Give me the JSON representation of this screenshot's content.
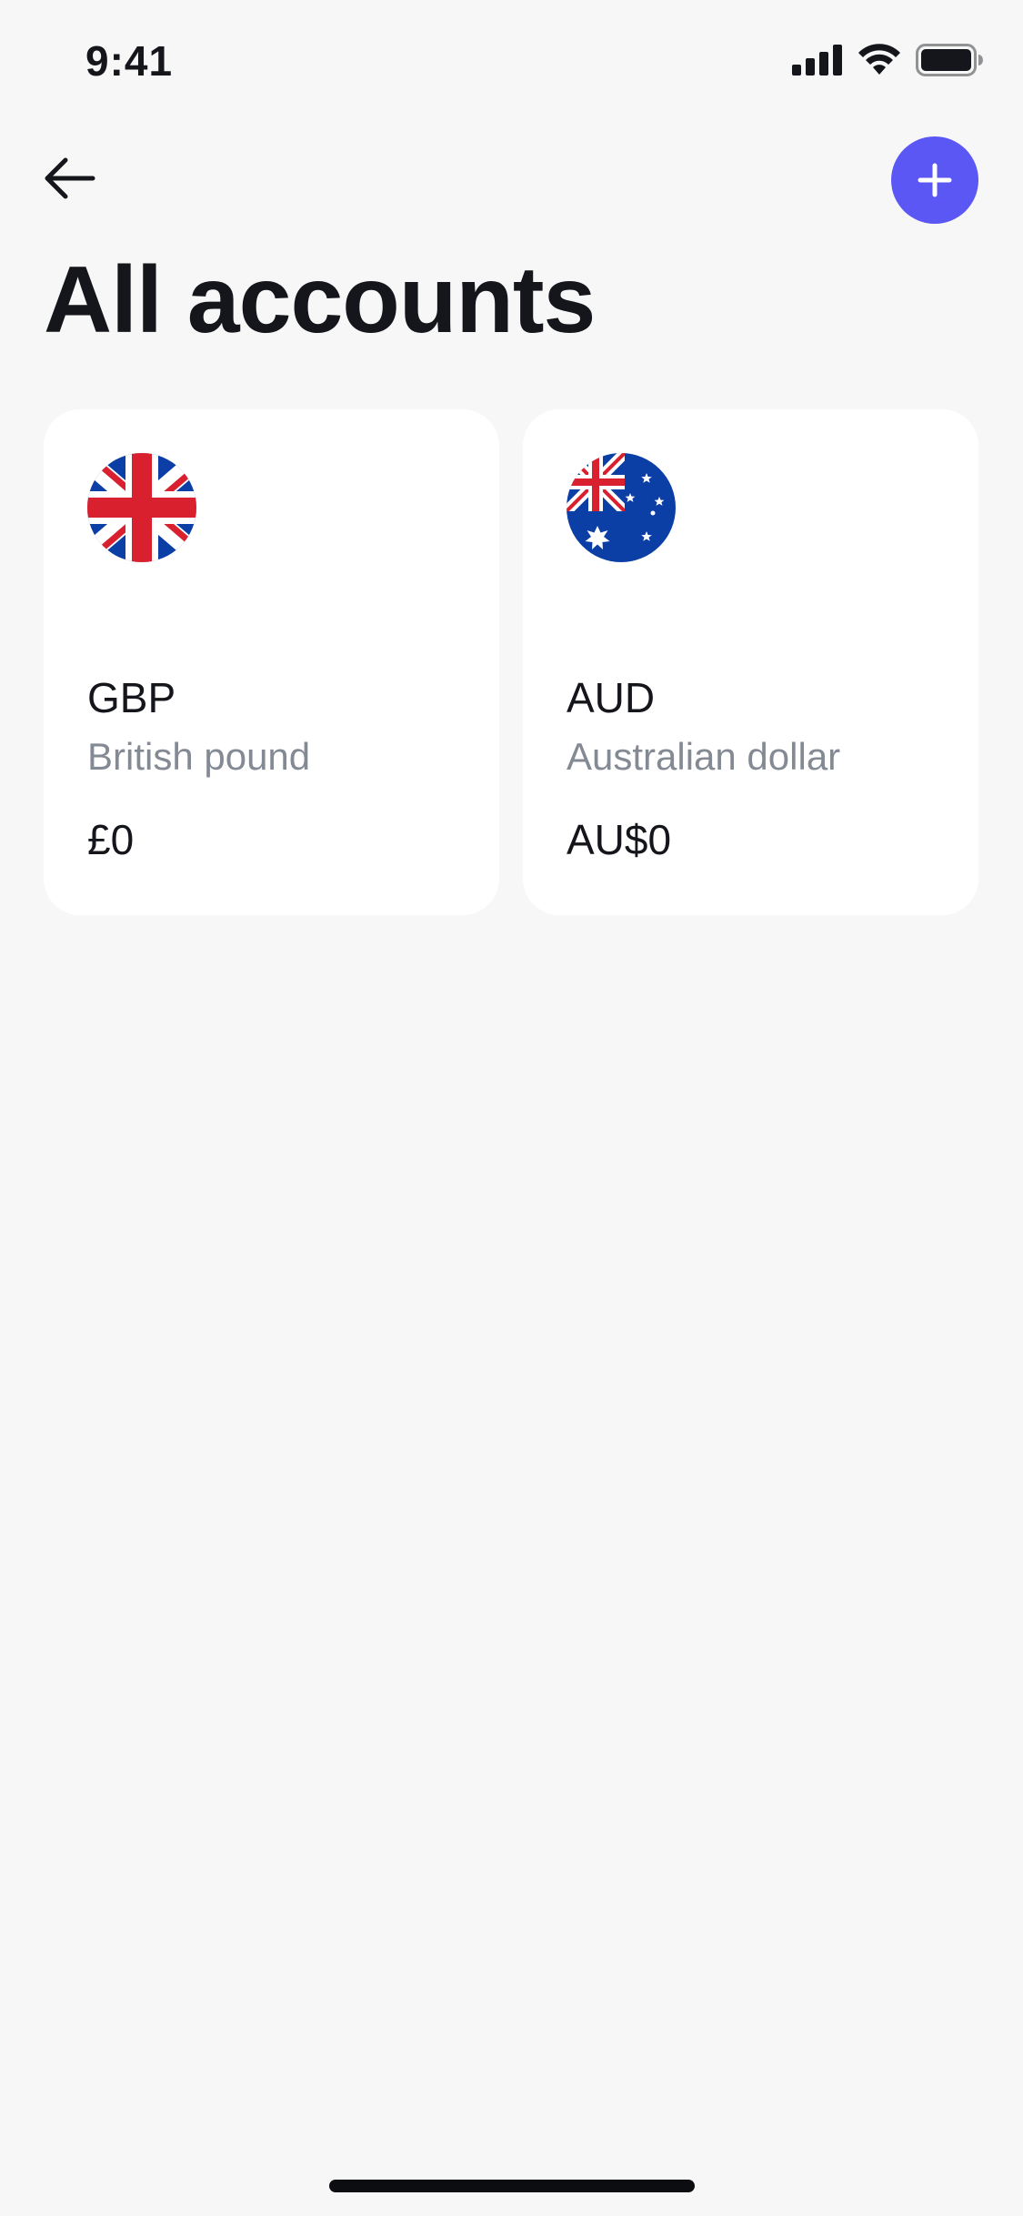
{
  "status_bar": {
    "time": "9:41"
  },
  "header": {
    "title": "All accounts",
    "back_icon": "arrow-left-icon",
    "add_icon": "plus-icon"
  },
  "accounts": [
    {
      "code": "GBP",
      "name": "British pound",
      "balance": "£0",
      "flag": "uk-flag-icon"
    },
    {
      "code": "AUD",
      "name": "Australian dollar",
      "balance": "AU$0",
      "flag": "australia-flag-icon"
    }
  ],
  "colors": {
    "background": "#f7f7f7",
    "accent": "#5b57f5",
    "card": "#ffffff",
    "text_primary": "#14161b",
    "text_secondary": "#848a94"
  }
}
